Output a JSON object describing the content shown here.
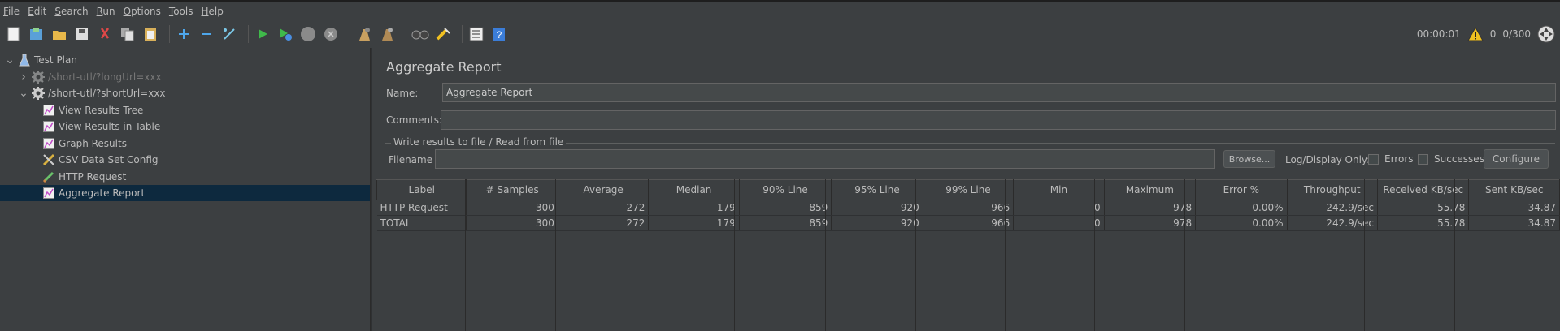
{
  "menu": [
    {
      "label": "File",
      "u": "F"
    },
    {
      "label": "Edit",
      "u": "E"
    },
    {
      "label": "Search",
      "u": "S"
    },
    {
      "label": "Run",
      "u": "R"
    },
    {
      "label": "Options",
      "u": "O"
    },
    {
      "label": "Tools",
      "u": "T"
    },
    {
      "label": "Help",
      "u": "H"
    }
  ],
  "toolbar": {
    "icons": [
      "new-icon",
      "templates-icon",
      "open-icon",
      "save-icon",
      "cut-icon",
      "copy-icon",
      "paste-icon",
      "expand-icon",
      "collapse-icon",
      "toggle-icon",
      "start-icon",
      "start-no-pauses-icon",
      "stop-icon",
      "shutdown-icon",
      "clear-icon",
      "clear-all-icon",
      "search-icon",
      "reset-search-icon",
      "function-helper-icon",
      "help-icon"
    ],
    "elapsed": "00:00:01",
    "warning_count": "0",
    "threads": "0/300"
  },
  "tree": [
    {
      "label": "Test Plan",
      "icon": "flask-icon",
      "indent": 0,
      "toggle": "v",
      "state": "normal"
    },
    {
      "label": "/short-utl/?longUrl=xxx",
      "icon": "gear-icon",
      "indent": 1,
      "toggle": ">",
      "state": "disabled"
    },
    {
      "label": "/short-utl/?shortUrl=xxx",
      "icon": "gear-icon",
      "indent": 1,
      "toggle": "v",
      "state": "normal"
    },
    {
      "label": "View Results Tree",
      "icon": "graph-icon",
      "indent": 2,
      "toggle": "",
      "state": "normal"
    },
    {
      "label": "View Results in Table",
      "icon": "graph-icon",
      "indent": 2,
      "toggle": "",
      "state": "normal"
    },
    {
      "label": "Graph Results",
      "icon": "graph-icon",
      "indent": 2,
      "toggle": "",
      "state": "normal"
    },
    {
      "label": "CSV Data Set Config",
      "icon": "wrench-icon",
      "indent": 2,
      "toggle": "",
      "state": "normal"
    },
    {
      "label": "HTTP Request",
      "icon": "pen-icon",
      "indent": 2,
      "toggle": "",
      "state": "normal"
    },
    {
      "label": "Aggregate Report",
      "icon": "graph-icon",
      "indent": 2,
      "toggle": "",
      "state": "selected"
    }
  ],
  "panel": {
    "title": "Aggregate Report",
    "name_label": "Name:",
    "name_value": "Aggregate Report",
    "comments_label": "Comments:",
    "comments_value": "",
    "fieldset_legend": "Write results to file / Read from file",
    "filename_label": "Filename",
    "filename_value": "",
    "browse_label": "Browse...",
    "log_display_label": "Log/Display Only:",
    "errors_label": "Errors",
    "successes_label": "Successes",
    "configure_label": "Configure"
  },
  "table": {
    "headers": [
      "Label",
      "# Samples",
      "Average",
      "Median",
      "90% Line",
      "95% Line",
      "99% Line",
      "Min",
      "Maximum",
      "Error %",
      "Throughput",
      "Received KB/sec",
      "Sent KB/sec"
    ],
    "rows": [
      [
        "HTTP Request",
        "300",
        "272",
        "179",
        "859",
        "920",
        "966",
        "0",
        "978",
        "0.00%",
        "242.9/sec",
        "55.78",
        "34.87"
      ],
      [
        "TOTAL",
        "300",
        "272",
        "179",
        "859",
        "920",
        "966",
        "0",
        "978",
        "0.00%",
        "242.9/sec",
        "55.78",
        "34.87"
      ]
    ]
  }
}
